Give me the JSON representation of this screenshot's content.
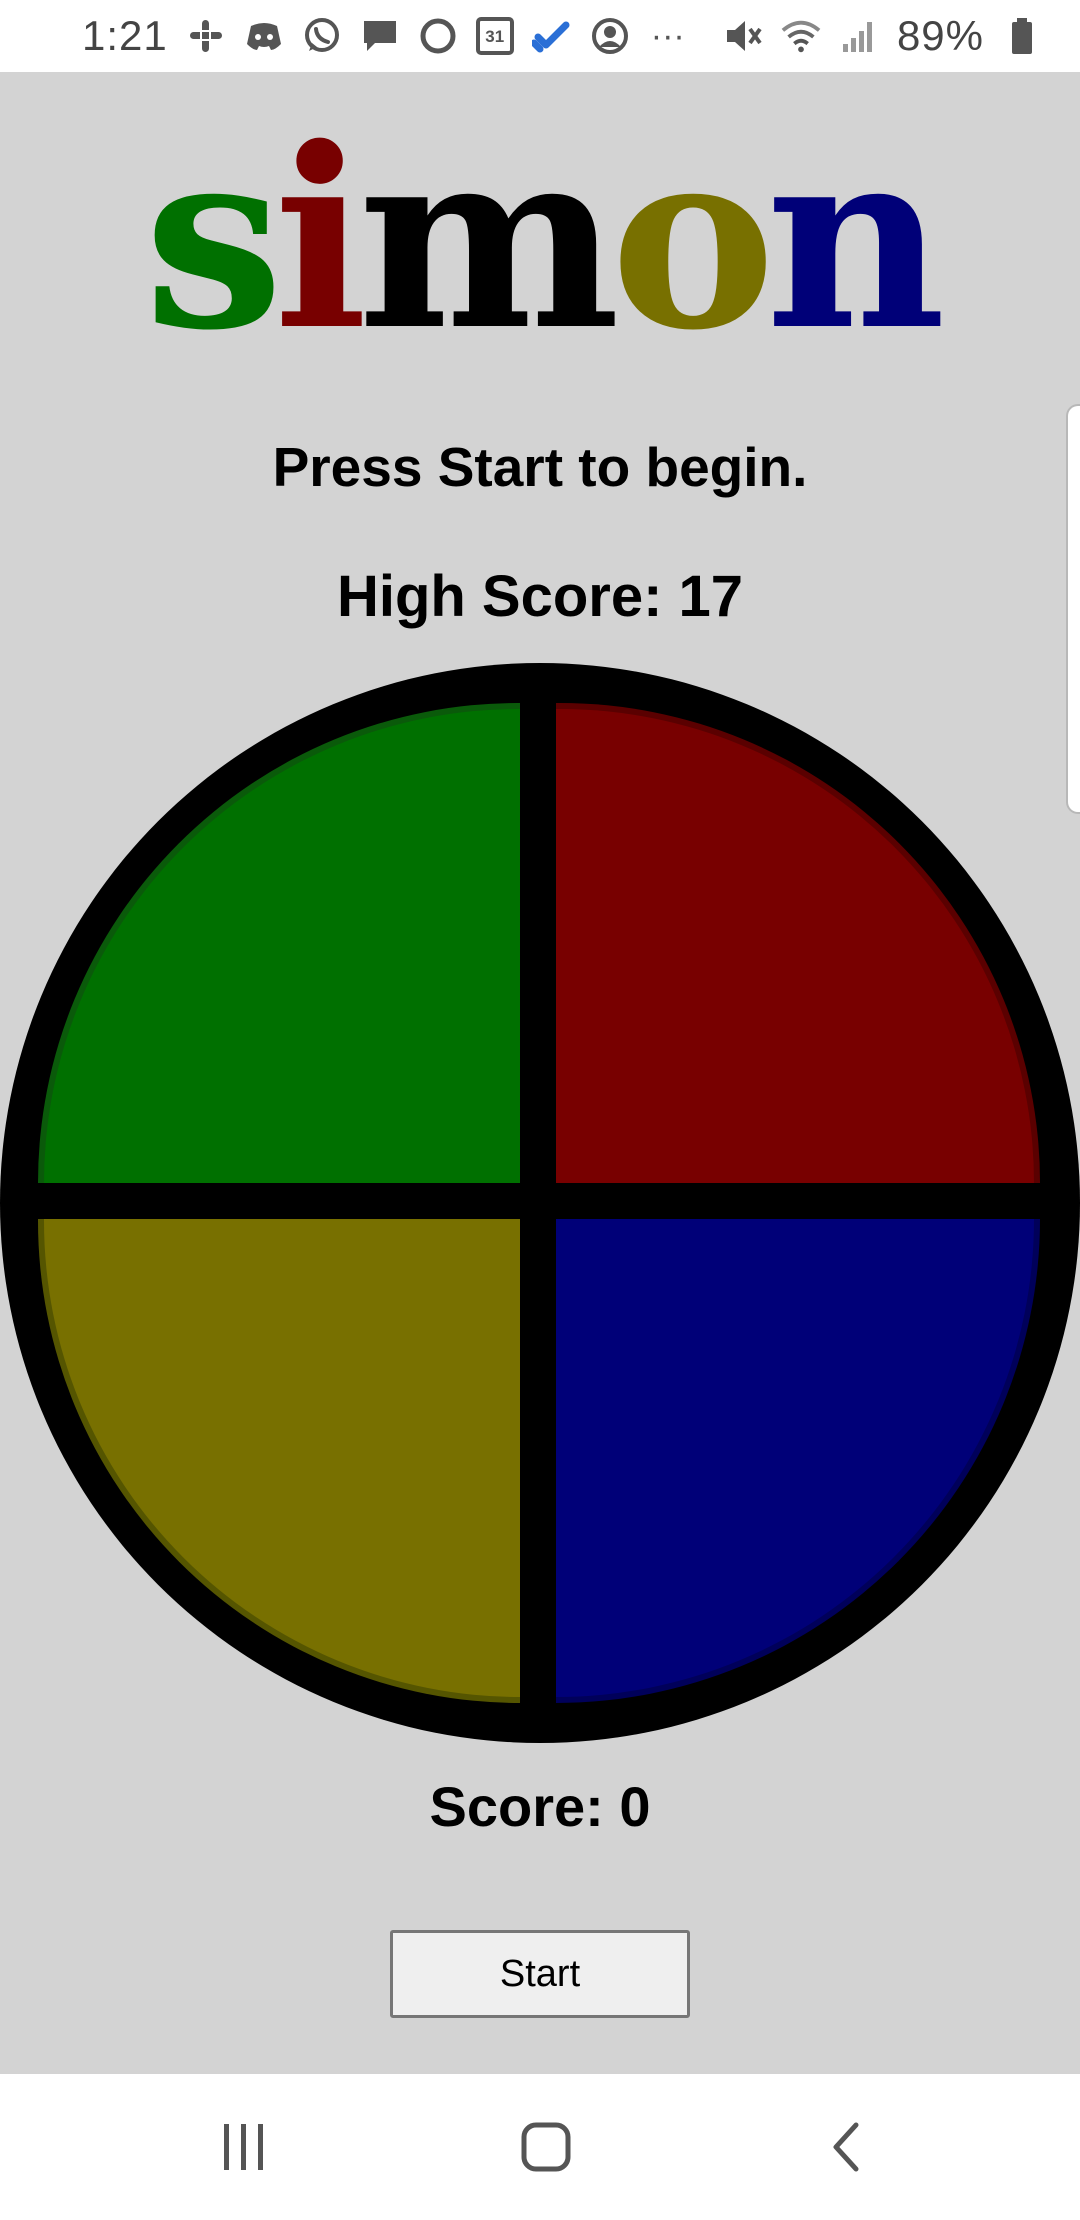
{
  "status_bar": {
    "time": "1:21",
    "battery": "89%",
    "left_icons": [
      "slack-icon",
      "discord-icon",
      "whatsapp-icon",
      "message-icon",
      "circle-app-icon",
      "calendar-icon",
      "tasks-icon",
      "account-icon",
      "more-icon"
    ],
    "calendar_day": "31",
    "more_label": "···",
    "right_icons": [
      "mute-icon",
      "wifi-icon",
      "signal-icon",
      "battery-icon"
    ]
  },
  "title": {
    "letters": [
      {
        "char": "s",
        "color": "#007000"
      },
      {
        "char": "i",
        "color": "#780000"
      },
      {
        "char": "m",
        "color": "#000000"
      },
      {
        "char": "o",
        "color": "#787000"
      },
      {
        "char": "n",
        "color": "#000078"
      }
    ]
  },
  "game": {
    "message": "Press Start to begin.",
    "high_score": "High Score: 17",
    "score": "Score: 0",
    "start_label": "Start",
    "pads": [
      {
        "id": "green",
        "color": "#007000"
      },
      {
        "id": "red",
        "color": "#780000"
      },
      {
        "id": "yellow",
        "color": "#787000"
      },
      {
        "id": "blue",
        "color": "#000078"
      }
    ]
  },
  "nav_bar": {
    "buttons": [
      "recent-apps",
      "home",
      "back"
    ]
  }
}
